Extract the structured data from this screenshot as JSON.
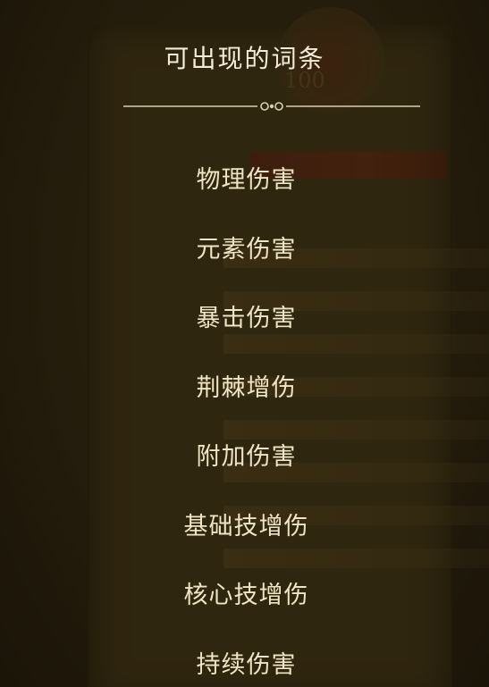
{
  "background": {
    "item_level": "100"
  },
  "popup": {
    "title": "可出现的词条",
    "affixes": [
      {
        "label": "物理伤害"
      },
      {
        "label": "元素伤害"
      },
      {
        "label": "暴击伤害"
      },
      {
        "label": "荆棘增伤"
      },
      {
        "label": "附加伤害"
      },
      {
        "label": "基础技增伤"
      },
      {
        "label": "核心技增伤"
      },
      {
        "label": "持续伤害"
      }
    ]
  },
  "colors": {
    "title_text": "#f3ecd8",
    "affix_text": "#efe4c4",
    "divider": "#d9cfb1",
    "panel": "#3f3416"
  }
}
